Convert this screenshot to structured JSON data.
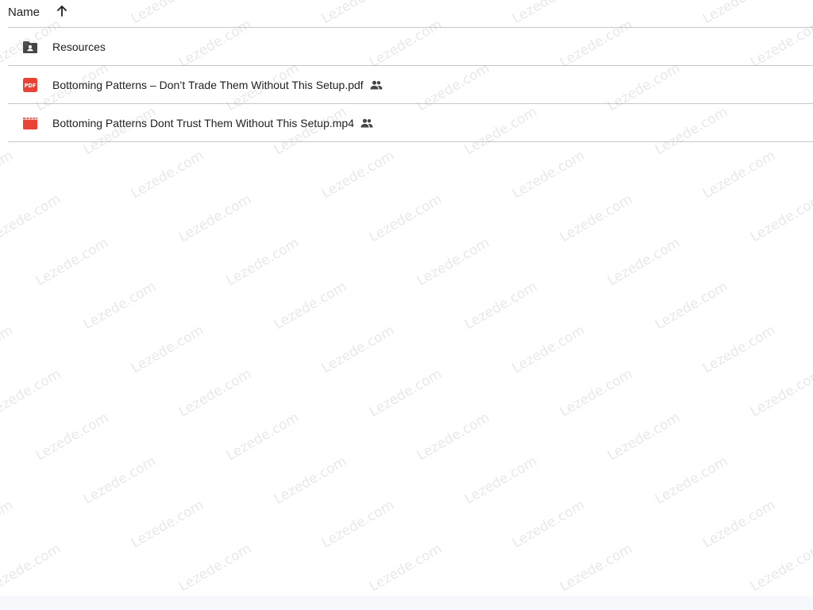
{
  "list": {
    "header": {
      "name_label": "Name",
      "sort_icon": "arrow-up-icon"
    },
    "rows": [
      {
        "name": "Resources",
        "type": "shared-folder",
        "icon": "shared-folder-icon",
        "shared": false
      },
      {
        "name": "Bottoming Patterns – Don’t Trade Them Without This Setup.pdf",
        "type": "pdf",
        "icon": "pdf-icon",
        "shared": true,
        "shared_icon": "people-icon"
      },
      {
        "name": "Bottoming Patterns Dont Trust Them Without This Setup.mp4",
        "type": "video",
        "icon": "video-icon",
        "shared": true,
        "shared_icon": "people-icon"
      }
    ]
  },
  "watermark": {
    "text": "Lezede.com"
  },
  "colors": {
    "folder_icon": "#444746",
    "pdf_red": "#ea4335",
    "video_red": "#ea4335",
    "divider": "#c7c7c7"
  }
}
